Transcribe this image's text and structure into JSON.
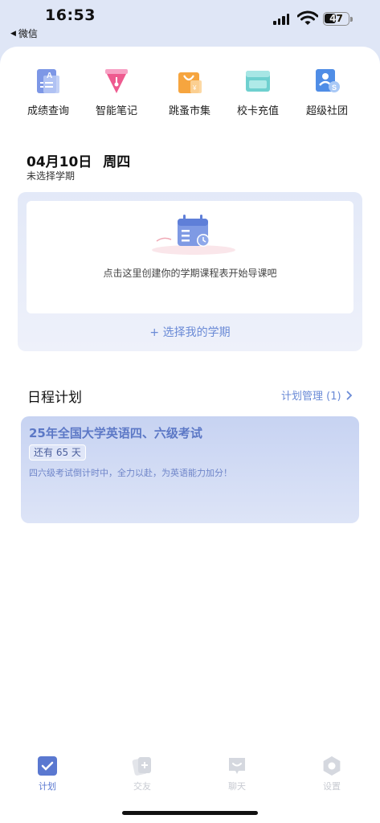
{
  "status": {
    "time": "16:53",
    "back_label": "微信",
    "battery": "47"
  },
  "quick_entries": [
    {
      "label": "成绩查询",
      "icon": "grade-report-icon"
    },
    {
      "label": "智能笔记",
      "icon": "pen-nib-icon"
    },
    {
      "label": "跳蚤市集",
      "icon": "shopping-bag-icon"
    },
    {
      "label": "校卡充值",
      "icon": "campus-card-icon"
    },
    {
      "label": "超级社团",
      "icon": "club-badge-icon"
    }
  ],
  "schedule": {
    "date": "04月10日",
    "weekday": "周四",
    "term_status": "未选择学期",
    "empty_tip": "点击这里创建你的学期课程表开始导课吧",
    "select_term": "+ 选择我的学期"
  },
  "plans": {
    "title": "日程计划",
    "manage": "计划管理 (1)",
    "items": [
      {
        "name": "25年全国大学英语四、六级考试",
        "countdown": "还有 65 天",
        "desc": "四六级考试倒计时中，全力以赴，为英语能力加分！"
      }
    ]
  },
  "tabs": [
    {
      "label": "计划",
      "icon": "plan-icon",
      "active": true
    },
    {
      "label": "交友",
      "icon": "friends-cards-icon",
      "active": false
    },
    {
      "label": "聊天",
      "icon": "chat-bubble-icon",
      "active": false
    },
    {
      "label": "设置",
      "icon": "gear-icon",
      "active": false
    }
  ],
  "colors": {
    "accent": "#5a78d0",
    "link": "#6a8ad6",
    "card_bg": "#c7d3f2"
  }
}
